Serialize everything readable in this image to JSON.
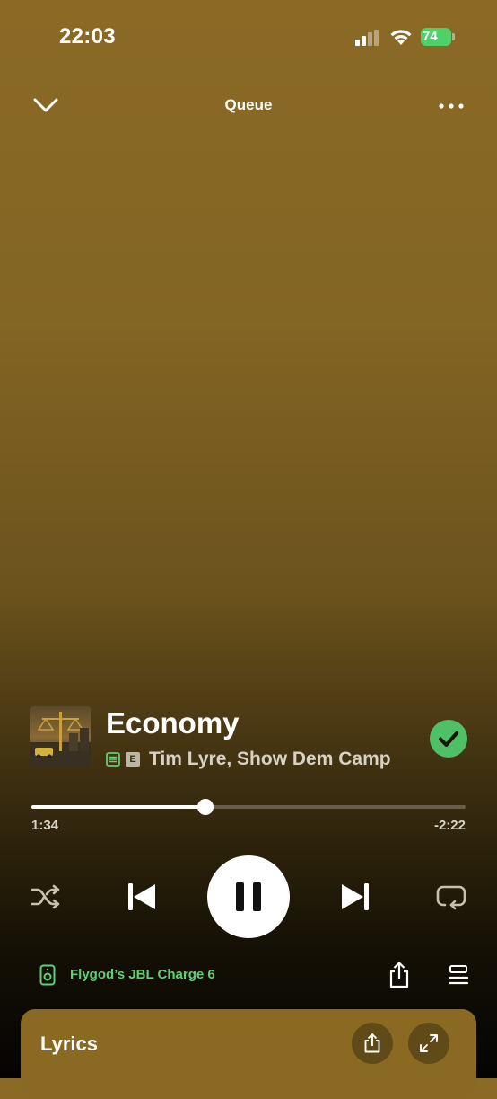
{
  "status_bar": {
    "time": "22:03",
    "battery": "74"
  },
  "header": {
    "title": "Queue"
  },
  "track": {
    "title": "Economy",
    "artists": "Tim Lyre, Show Dem Camp",
    "explicit_badge": "E",
    "liked": true
  },
  "playback": {
    "elapsed": "1:34",
    "remaining": "-2:22",
    "progress_fraction": 0.4
  },
  "device": {
    "name": "Flygod’s JBL Charge 6"
  },
  "lyrics": {
    "label": "Lyrics"
  },
  "colors": {
    "accent_green": "#50c066",
    "device_green": "#5fd172",
    "lyrics_card": "#8a6a23"
  },
  "icons": [
    "signal-icon",
    "wifi-icon",
    "battery-icon",
    "chevron-down-icon",
    "more-icon",
    "lyrics-badge-icon",
    "check-icon",
    "shuffle-icon",
    "previous-icon",
    "pause-icon",
    "next-icon",
    "repeat-icon",
    "speaker-icon",
    "share-icon",
    "queue-icon",
    "expand-icon"
  ]
}
